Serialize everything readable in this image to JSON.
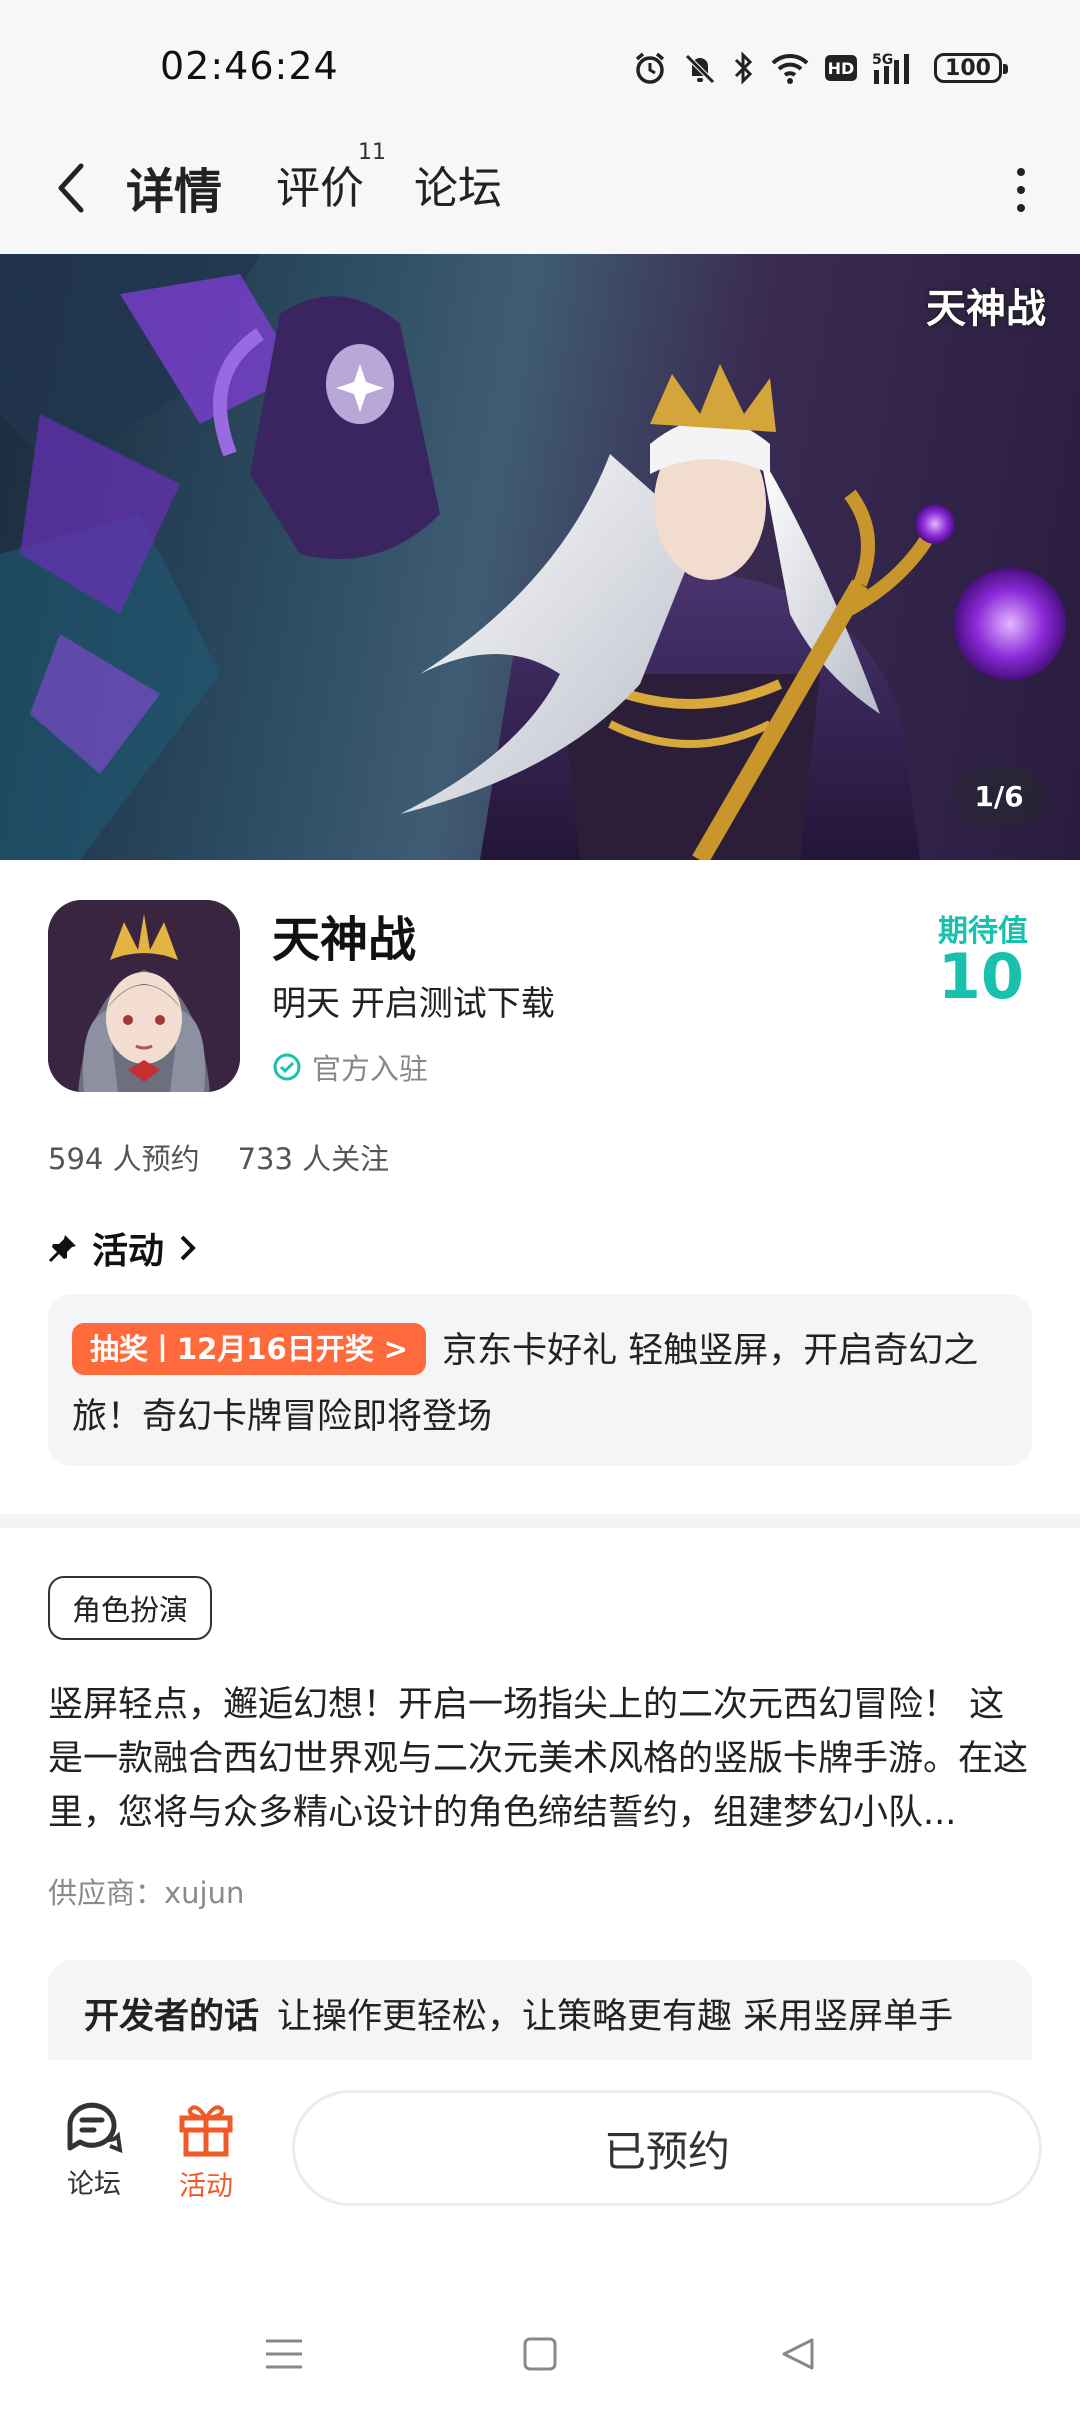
{
  "status_bar": {
    "time": "02:46:24",
    "battery": "100",
    "icons": [
      "alarm-icon",
      "mute-icon",
      "bluetooth-icon",
      "wifi-icon",
      "hd-icon",
      "5g-signal-icon",
      "battery-icon"
    ]
  },
  "nav": {
    "tabs": {
      "detail": "详情",
      "review": "评价",
      "review_count": "11",
      "forum": "论坛"
    },
    "accent_color": "#19c7b3"
  },
  "banner": {
    "logo_text": "天神战",
    "counter": "1/6"
  },
  "app": {
    "name": "天神战",
    "subtitle": "明天 开启测试下载",
    "official": "官方入驻",
    "expect_label": "期待值",
    "expect_value": "10",
    "reservations": "594 人预约",
    "followers": "733 人关注"
  },
  "activity": {
    "title": "活动",
    "pill": "抽奖丨12月16日开奖 >",
    "text": "京东卡好礼 轻触竖屏，开启奇幻之旅！奇幻卡牌冒险即将登场"
  },
  "details": {
    "genre_tag": "角色扮演",
    "description": "竖屏轻点，邂逅幻想！开启一场指尖上的二次元西幻冒险！ 这是一款融合西幻世界观与二次元美术风格的竖版卡牌手游。在这里，您将与众多精心设计的角色缔结誓约，组建梦幻小队...",
    "vendor": "供应商：xujun"
  },
  "developer_note": {
    "title": "开发者的话",
    "text": "让操作更轻松，让策略更有趣 采用竖屏单手"
  },
  "bottom_bar": {
    "forum_label": "论坛",
    "activity_label": "活动",
    "reserve_label": "已预约",
    "activity_color": "#f05a28"
  }
}
